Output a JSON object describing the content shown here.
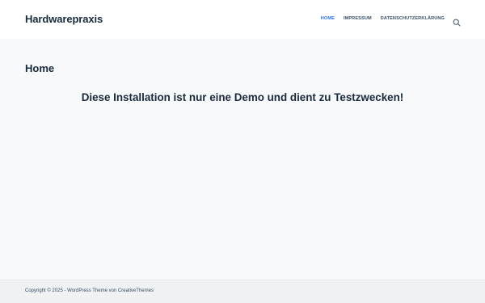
{
  "header": {
    "site_title": "Hardwarepraxis",
    "nav": [
      {
        "label": "HOME"
      },
      {
        "label": "IMPRESSUM"
      },
      {
        "label": "DATENSCHUTZERKLÄRUNG"
      }
    ],
    "active_color": "#2872fa",
    "search_icon": "search-icon"
  },
  "main": {
    "page_title": "Home",
    "content_text": "Diese Installation ist nur eine Demo und dient zu Testzwecken!"
  },
  "footer": {
    "copyright": "Copyright © 2025 - WordPress Theme von CreativeThemes"
  }
}
